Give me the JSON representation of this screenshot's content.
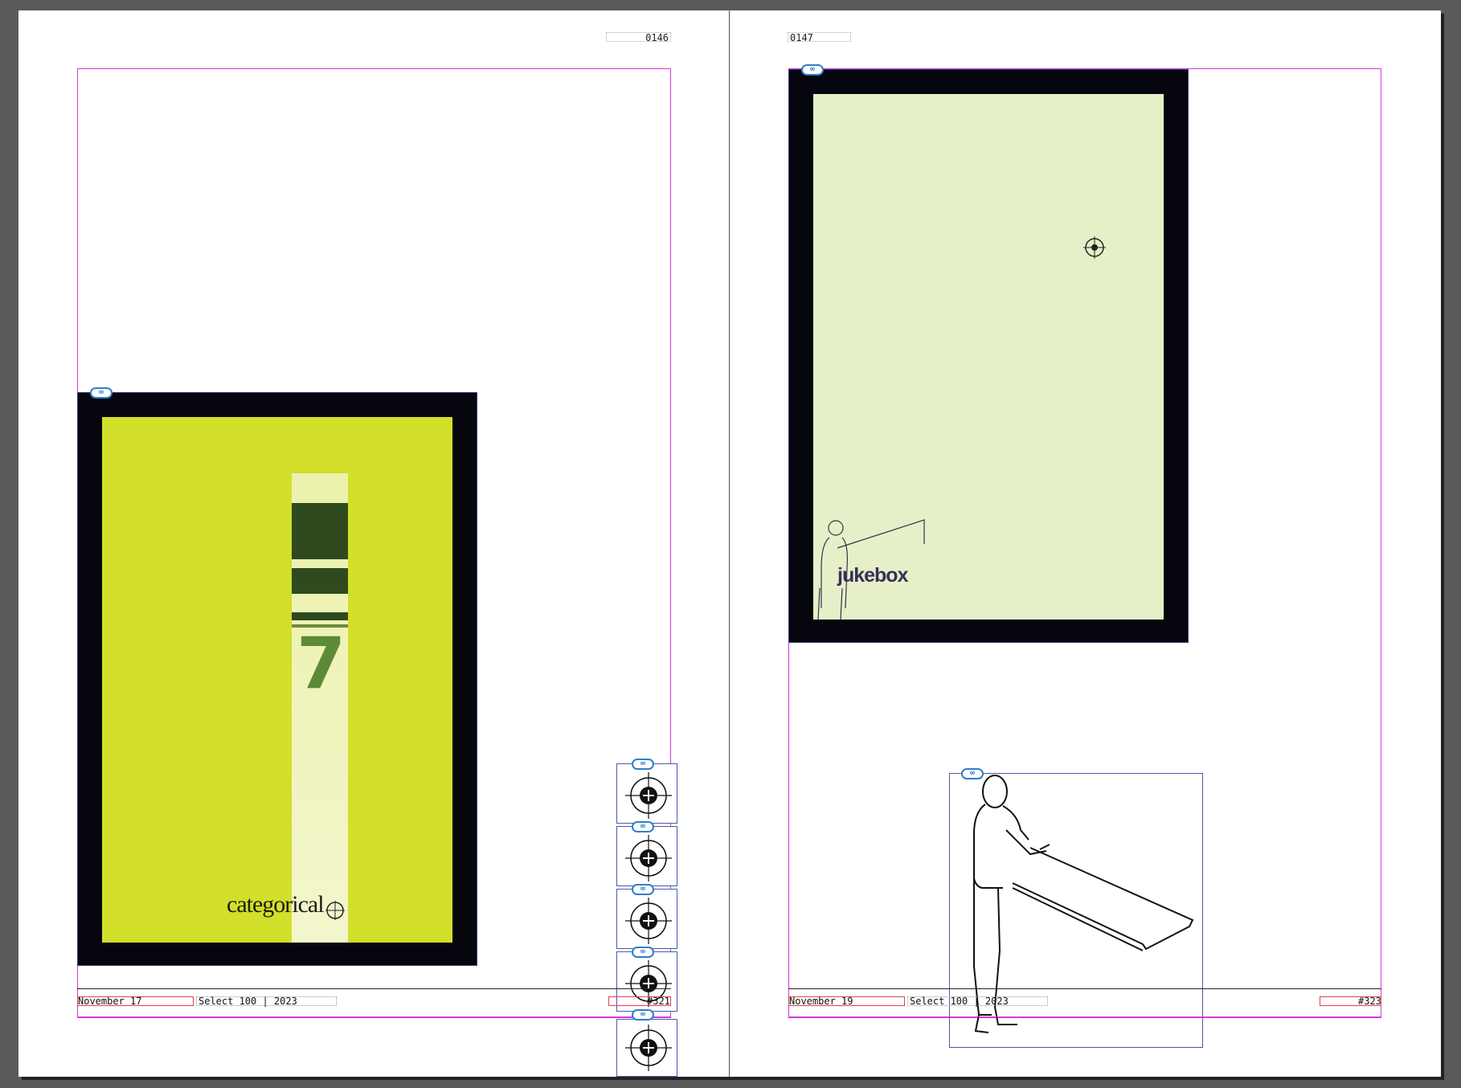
{
  "app": {
    "window": "InDesign spread view",
    "accent_color": "#d23ad8",
    "frame_color": "#4a5aa8",
    "link_icon": "chain-link-icon"
  },
  "pages": {
    "left": {
      "page_number": "0146",
      "footer_date": "November 17",
      "footer_title": "Select 100 | 2023",
      "footer_issue": "#321",
      "poster": {
        "word": "categorical",
        "number": "7",
        "background": "#d2df2b",
        "border": "#05060d"
      }
    },
    "right": {
      "page_number": "0147",
      "footer_date": "November 19",
      "footer_title": "Select 100 | 2023",
      "footer_issue": "#323",
      "poster": {
        "word": "jukebox",
        "background": "#e5f0c8",
        "border": "#05060d"
      }
    }
  }
}
